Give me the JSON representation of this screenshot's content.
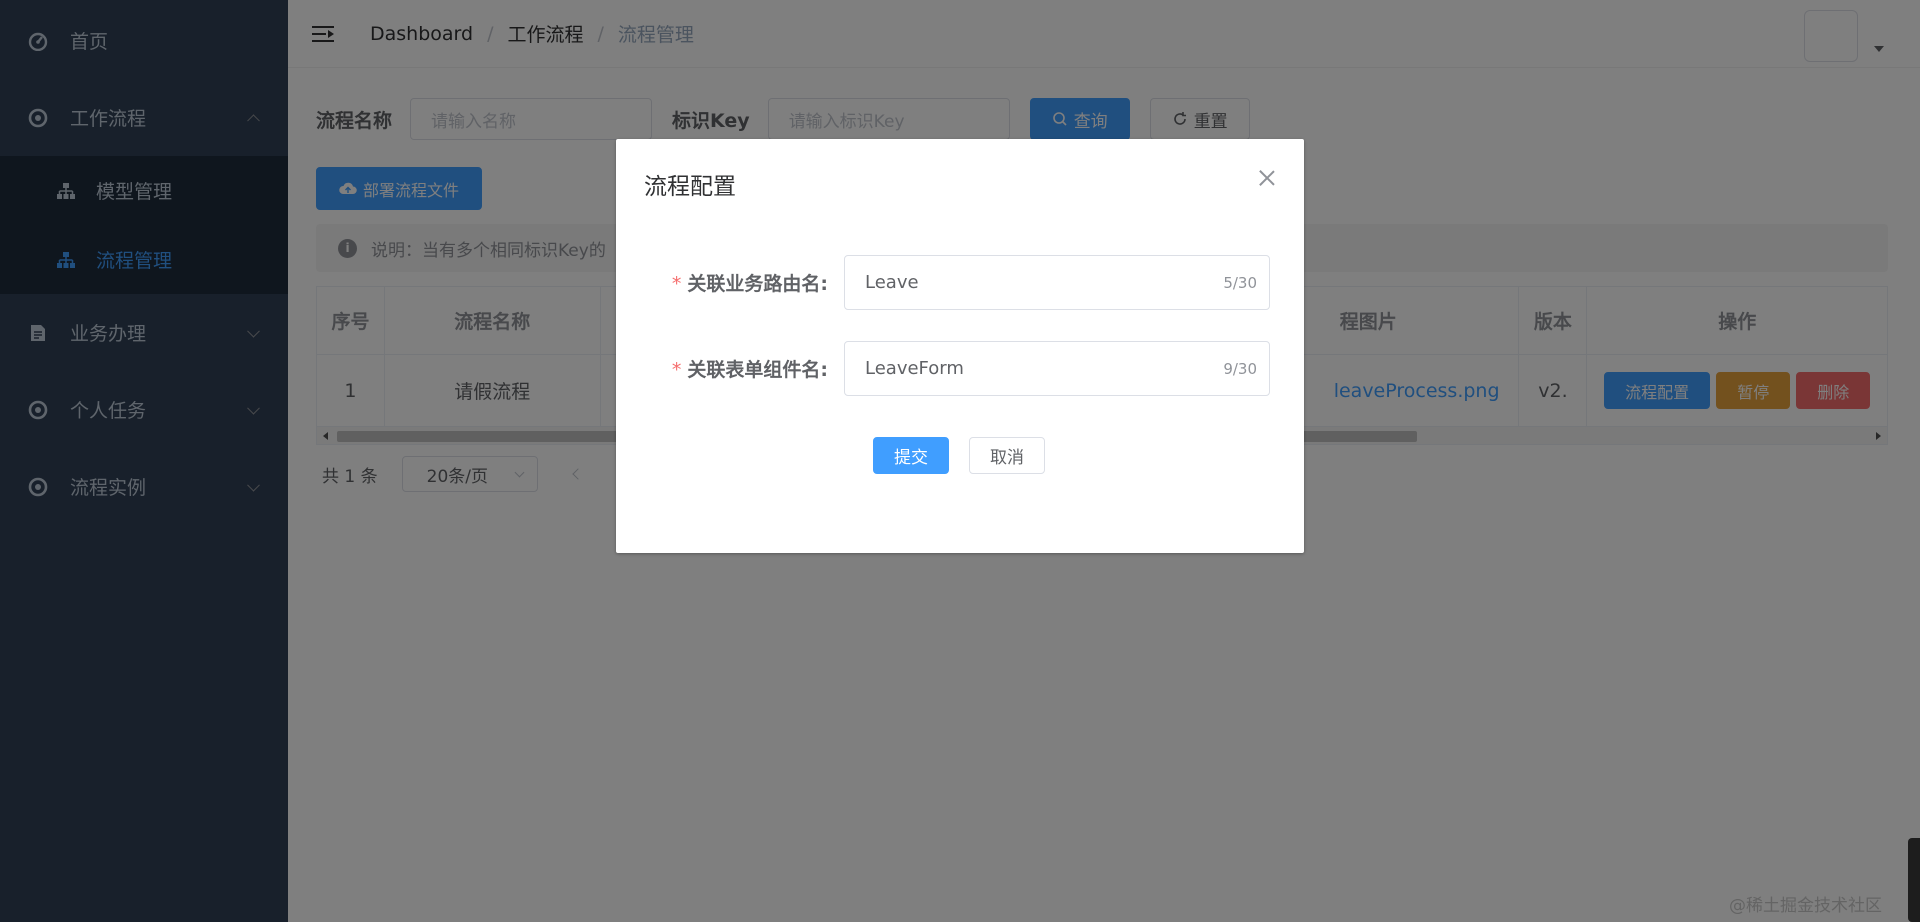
{
  "sidebar": {
    "items": [
      {
        "label": "首页",
        "icon": "dashboard-icon"
      },
      {
        "label": "工作流程",
        "icon": "workflow-icon",
        "expanded": true,
        "children": [
          {
            "label": "模型管理",
            "icon": "tree-icon",
            "active": false
          },
          {
            "label": "流程管理",
            "icon": "tree-icon",
            "active": true
          }
        ]
      },
      {
        "label": "业务办理",
        "icon": "document-icon"
      },
      {
        "label": "个人任务",
        "icon": "workflow-icon"
      },
      {
        "label": "流程实例",
        "icon": "workflow-icon"
      }
    ],
    "bg_color": "#304156",
    "active_color": "#409eff"
  },
  "navbar": {
    "breadcrumb": [
      "Dashboard",
      "工作流程",
      "流程管理"
    ]
  },
  "search": {
    "name_label": "流程名称",
    "name_placeholder": "请输入名称",
    "key_label": "标识Key",
    "key_placeholder": "请输入标识Key",
    "query_button": "查询",
    "reset_button": "重置"
  },
  "toolbar": {
    "deploy_button": "部署流程文件"
  },
  "tip": {
    "text": "说明：当有多个相同标识Key的"
  },
  "table": {
    "headers": [
      "序号",
      "流程名称",
      "程图片",
      "版本",
      "操作"
    ],
    "rows": [
      {
        "index": "1",
        "name": "请假流程",
        "image": "leaveProcess.png",
        "version": "v2."
      }
    ],
    "row_actions": [
      "流程配置",
      "暂停",
      "删除"
    ]
  },
  "pagination": {
    "total": "共 1 条",
    "page_size": "20条/页"
  },
  "dialog": {
    "title": "流程配置",
    "fields": [
      {
        "label": "关联业务路由名:",
        "value": "Leave",
        "count": "5/30"
      },
      {
        "label": "关联表单组件名:",
        "value": "LeaveForm",
        "count": "9/30"
      }
    ],
    "submit_button": "提交",
    "cancel_button": "取消"
  },
  "watermark": "@稀土掘金技术社区",
  "colors": {
    "primary": "#409eff",
    "warning": "#e6a23c",
    "danger": "#f56c6c"
  }
}
